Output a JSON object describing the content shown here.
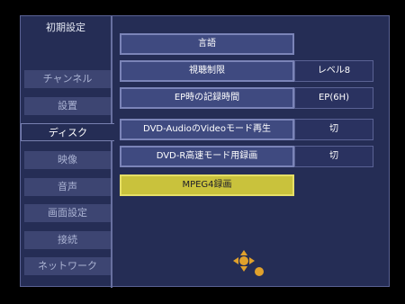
{
  "sidebar": {
    "title": "初期設定",
    "items": [
      {
        "label": "チャンネル",
        "active": false
      },
      {
        "label": "設置",
        "active": false
      },
      {
        "label": "ディスク",
        "active": true
      },
      {
        "label": "映像",
        "active": false
      },
      {
        "label": "音声",
        "active": false
      },
      {
        "label": "画面設定",
        "active": false
      },
      {
        "label": "接続",
        "active": false
      },
      {
        "label": "ネットワーク",
        "active": false
      }
    ]
  },
  "menu": {
    "items": [
      {
        "label": "言語",
        "value": ""
      },
      {
        "label": "視聴制限",
        "value": "レベル8"
      },
      {
        "label": "EP時の記録時間",
        "value": "EP(6H)"
      },
      {
        "label": "DVD-AudioのVideoモード再生",
        "value": "切"
      },
      {
        "label": "DVD-R高速モード用録画",
        "value": "切"
      },
      {
        "label": "MPEG4録画",
        "value": "",
        "selected": true
      }
    ]
  },
  "navigation": {
    "icon": "dpad-navigation-icon"
  },
  "colors": {
    "panel": "#252d55",
    "button": "#3f4a80",
    "selected": "#c9c23c",
    "navigation": "#e0a12c"
  }
}
